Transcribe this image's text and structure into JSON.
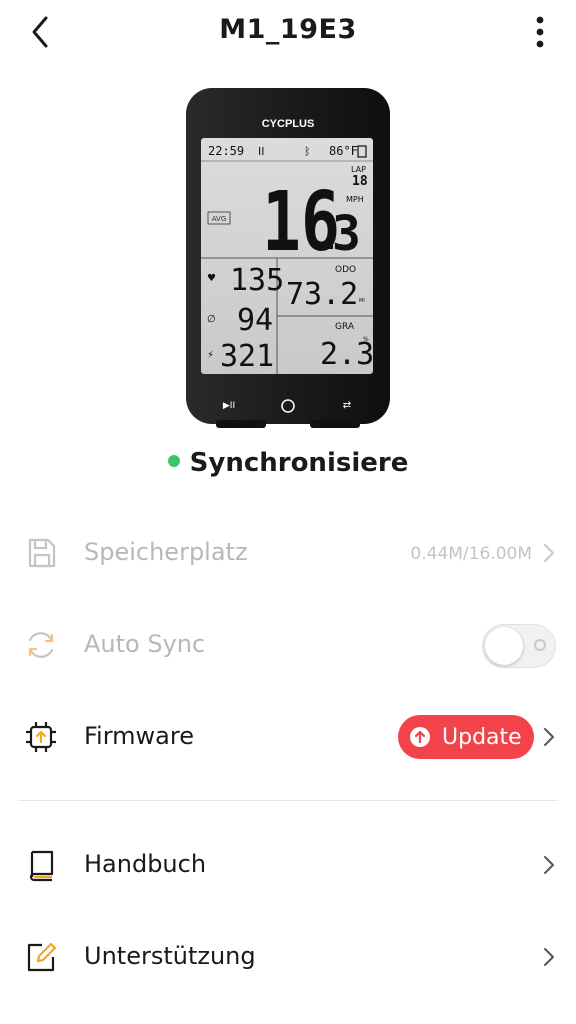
{
  "header": {
    "title": "M1_19E3",
    "back_icon": "chevron-left-icon",
    "more_icon": "more-vertical-icon"
  },
  "device": {
    "brand": "CYCPLUS",
    "time": "22:59",
    "temperature": "86°F",
    "lap_label": "LAP",
    "lap_value": "18",
    "speed_unit": "MPH",
    "speed_int": "16",
    "speed_dec": "3",
    "avg_label": "AVG",
    "heart_rate": "135",
    "cadence": "94",
    "power": "321",
    "odo_label": "ODO",
    "odo_value": "73.2",
    "odo_unit": "MI",
    "gra_label": "GRA",
    "gra_value": "2.3",
    "gra_unit": "%"
  },
  "status": {
    "text": "Synchronisiere",
    "dot_color": "#3cc46a"
  },
  "settings": {
    "storage": {
      "label": "Speicherplatz",
      "value": "0.44M/16.00M",
      "icon": "sd-card-icon"
    },
    "auto_sync": {
      "label": "Auto Sync",
      "enabled": false,
      "icon": "sync-icon"
    },
    "firmware": {
      "label": "Firmware",
      "badge": "Update",
      "icon": "chip-upload-icon"
    },
    "manual": {
      "label": "Handbuch",
      "icon": "book-icon"
    },
    "support": {
      "label": "Unterstützung",
      "icon": "edit-note-icon"
    }
  },
  "colors": {
    "accent_red": "#f2434a",
    "accent_orange": "#f5a623",
    "disabled_text": "#b8b8b8"
  }
}
